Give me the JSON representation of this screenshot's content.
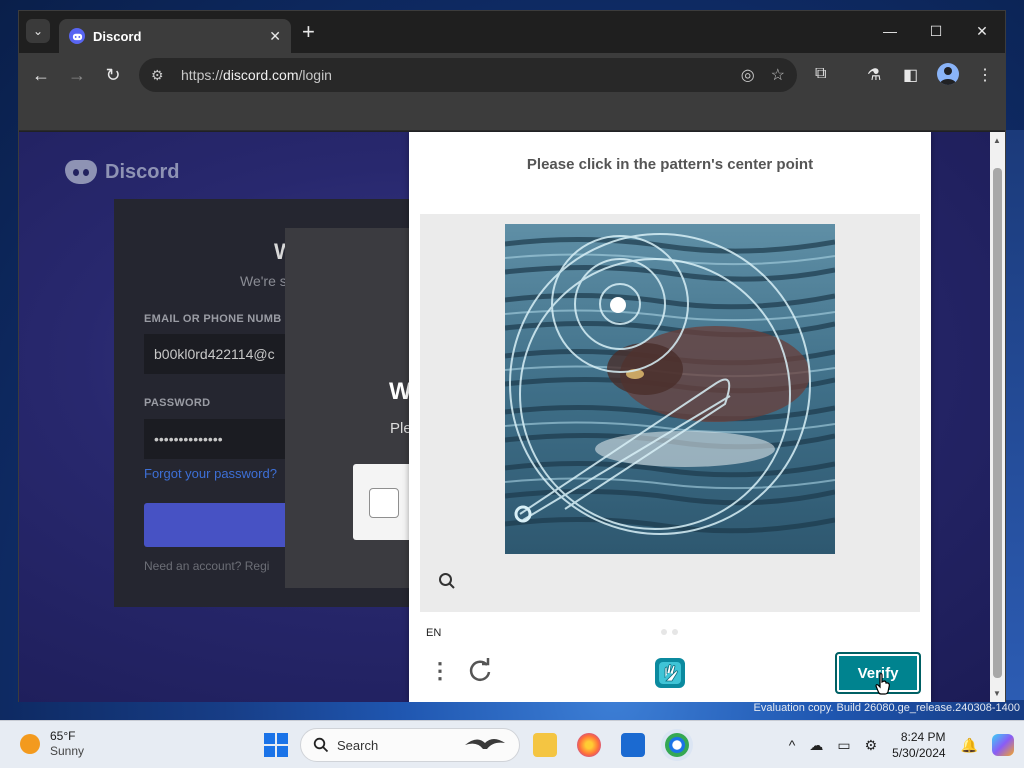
{
  "browser": {
    "tab_title": "Discord",
    "url_scheme": "https://",
    "url_host": "discord.com",
    "url_path": "/login"
  },
  "discord": {
    "brand": "Discord",
    "heading_partial": "W",
    "subtitle_partial": "We're s",
    "email_label": "EMAIL OR PHONE NUMB",
    "email_value": "b00kl0rd422114@c",
    "password_label": "PASSWORD",
    "password_value": "••••••••••••••",
    "forgot_link": "Forgot your password?",
    "register_text": "Need an account? Regi",
    "overlay_title_partial": "W",
    "overlay_sub_partial": "Ple"
  },
  "captcha": {
    "prompt": "Please click in the pattern's center point",
    "language": "EN",
    "verify_label": "Verify"
  },
  "desktop": {
    "evaluation_text": "Evaluation copy. Build 26080.ge_release.240308-1400"
  },
  "taskbar": {
    "temperature": "65°F",
    "condition": "Sunny",
    "search_placeholder": "Search",
    "time": "8:24 PM",
    "date": "5/30/2024"
  }
}
